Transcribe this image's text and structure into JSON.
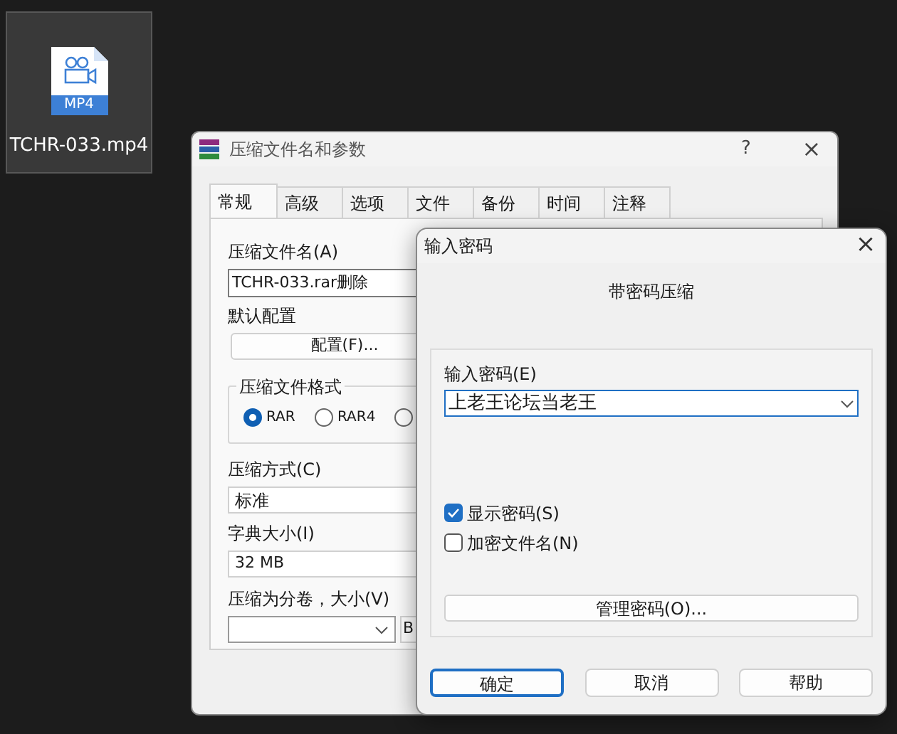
{
  "desktop_icon": {
    "icon_label": "MP4",
    "label": "TCHR-033.mp4",
    "selected": true
  },
  "main_window": {
    "title": "压缩文件名和参数",
    "help_button": "?",
    "close_button": "×",
    "tabs": [
      {
        "label": "常规",
        "selected": true
      },
      {
        "label": "高级",
        "selected": false
      },
      {
        "label": "选项",
        "selected": false
      },
      {
        "label": "文件",
        "selected": false
      },
      {
        "label": "备份",
        "selected": false
      },
      {
        "label": "时间",
        "selected": false
      },
      {
        "label": "注释",
        "selected": false
      }
    ],
    "archive_name": {
      "label": "压缩文件名(A)",
      "value": "TCHR-033.rar删除"
    },
    "default_profile": {
      "label": "默认配置",
      "button": "配置(F)..."
    },
    "format_group": {
      "title": "压缩文件格式",
      "options": [
        {
          "label": "RAR",
          "selected": true
        },
        {
          "label": "RAR4",
          "selected": false
        },
        {
          "selected": false
        }
      ]
    },
    "method": {
      "label": "压缩方式(C)",
      "value": "标准"
    },
    "dictionary": {
      "label": "字典大小(I)",
      "value": "32 MB"
    },
    "volumes": {
      "label": "压缩为分卷，大小(V)",
      "unit_button": "B"
    }
  },
  "password_dialog": {
    "title": "输入密码",
    "close_button": "×",
    "heading": "带密码压缩",
    "password": {
      "label": "输入密码(E)",
      "value": "上老王论坛当老王"
    },
    "options": [
      {
        "label": "显示密码(S)",
        "checked": true
      },
      {
        "label": "加密文件名(N)",
        "checked": false
      }
    ],
    "manage_button": "管理密码(O)...",
    "buttons": [
      {
        "label": "确定",
        "default": true
      },
      {
        "label": "取消",
        "default": false
      },
      {
        "label": "帮助",
        "default": false
      }
    ]
  }
}
